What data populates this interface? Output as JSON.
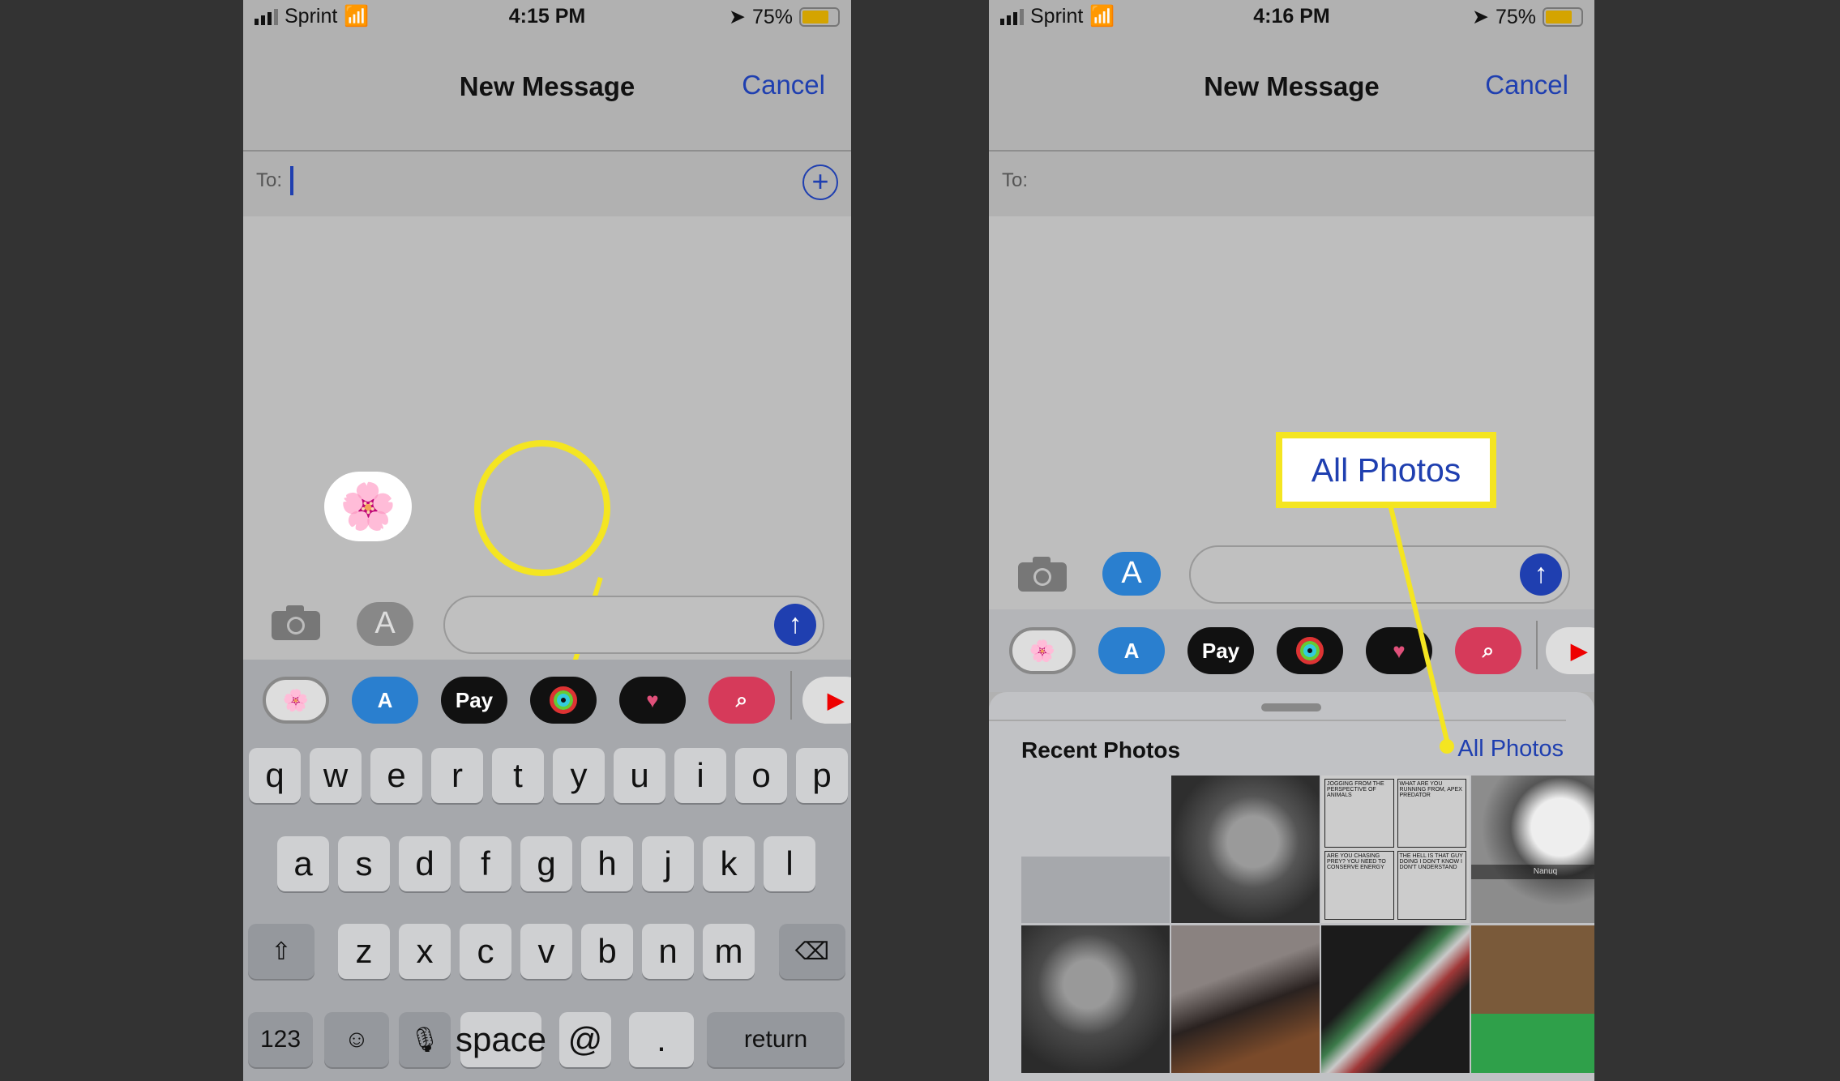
{
  "left": {
    "status": {
      "carrier": "Sprint",
      "time": "4:15 PM",
      "battery": "75%",
      "battery_level": 0.75
    },
    "header": {
      "title": "New Message",
      "cancel": "Cancel"
    },
    "to_label": "To:",
    "apps": [
      {
        "icon": "photos-icon"
      },
      {
        "icon": "app-store-icon"
      },
      {
        "icon": "apple-pay-icon",
        "label": "Pay"
      },
      {
        "icon": "activity-icon"
      },
      {
        "icon": "digital-touch-icon"
      },
      {
        "icon": "image-search-icon"
      },
      {
        "icon": "youtube-icon"
      }
    ],
    "keyboard": {
      "row1": [
        "q",
        "w",
        "e",
        "r",
        "t",
        "y",
        "u",
        "i",
        "o",
        "p"
      ],
      "row2": [
        "a",
        "s",
        "d",
        "f",
        "g",
        "h",
        "j",
        "k",
        "l"
      ],
      "row3": [
        "z",
        "x",
        "c",
        "v",
        "b",
        "n",
        "m"
      ],
      "shift": "⇧",
      "delete": "⌫",
      "numbers": "123",
      "emoji": "☺",
      "mic": "🎙",
      "space": "space",
      "at": "@",
      "period": ".",
      "return": "return"
    }
  },
  "right": {
    "status": {
      "carrier": "Sprint",
      "time": "4:16 PM",
      "battery": "75%",
      "battery_level": 0.75
    },
    "header": {
      "title": "New Message",
      "cancel": "Cancel"
    },
    "to_label": "To:",
    "callout": "All Photos",
    "recent_photos": "Recent Photos",
    "all_photos": "All Photos",
    "photo_label": "Nanuq",
    "comic": [
      "JOGGING FROM THE PERSPECTIVE OF ANIMALS",
      "WHAT ARE YOU RUNNING FROM, APEX PREDATOR",
      "ARE YOU CHASING PREY?",
      "YOU NEED TO CONSERVE ENERGY",
      "THE HELL IS THAT GUY DOING",
      "I DON'T KNOW I DON'T UNDERSTAND"
    ]
  },
  "colors": {
    "accent": "#1f3fb0",
    "highlight": "#f4e521"
  }
}
